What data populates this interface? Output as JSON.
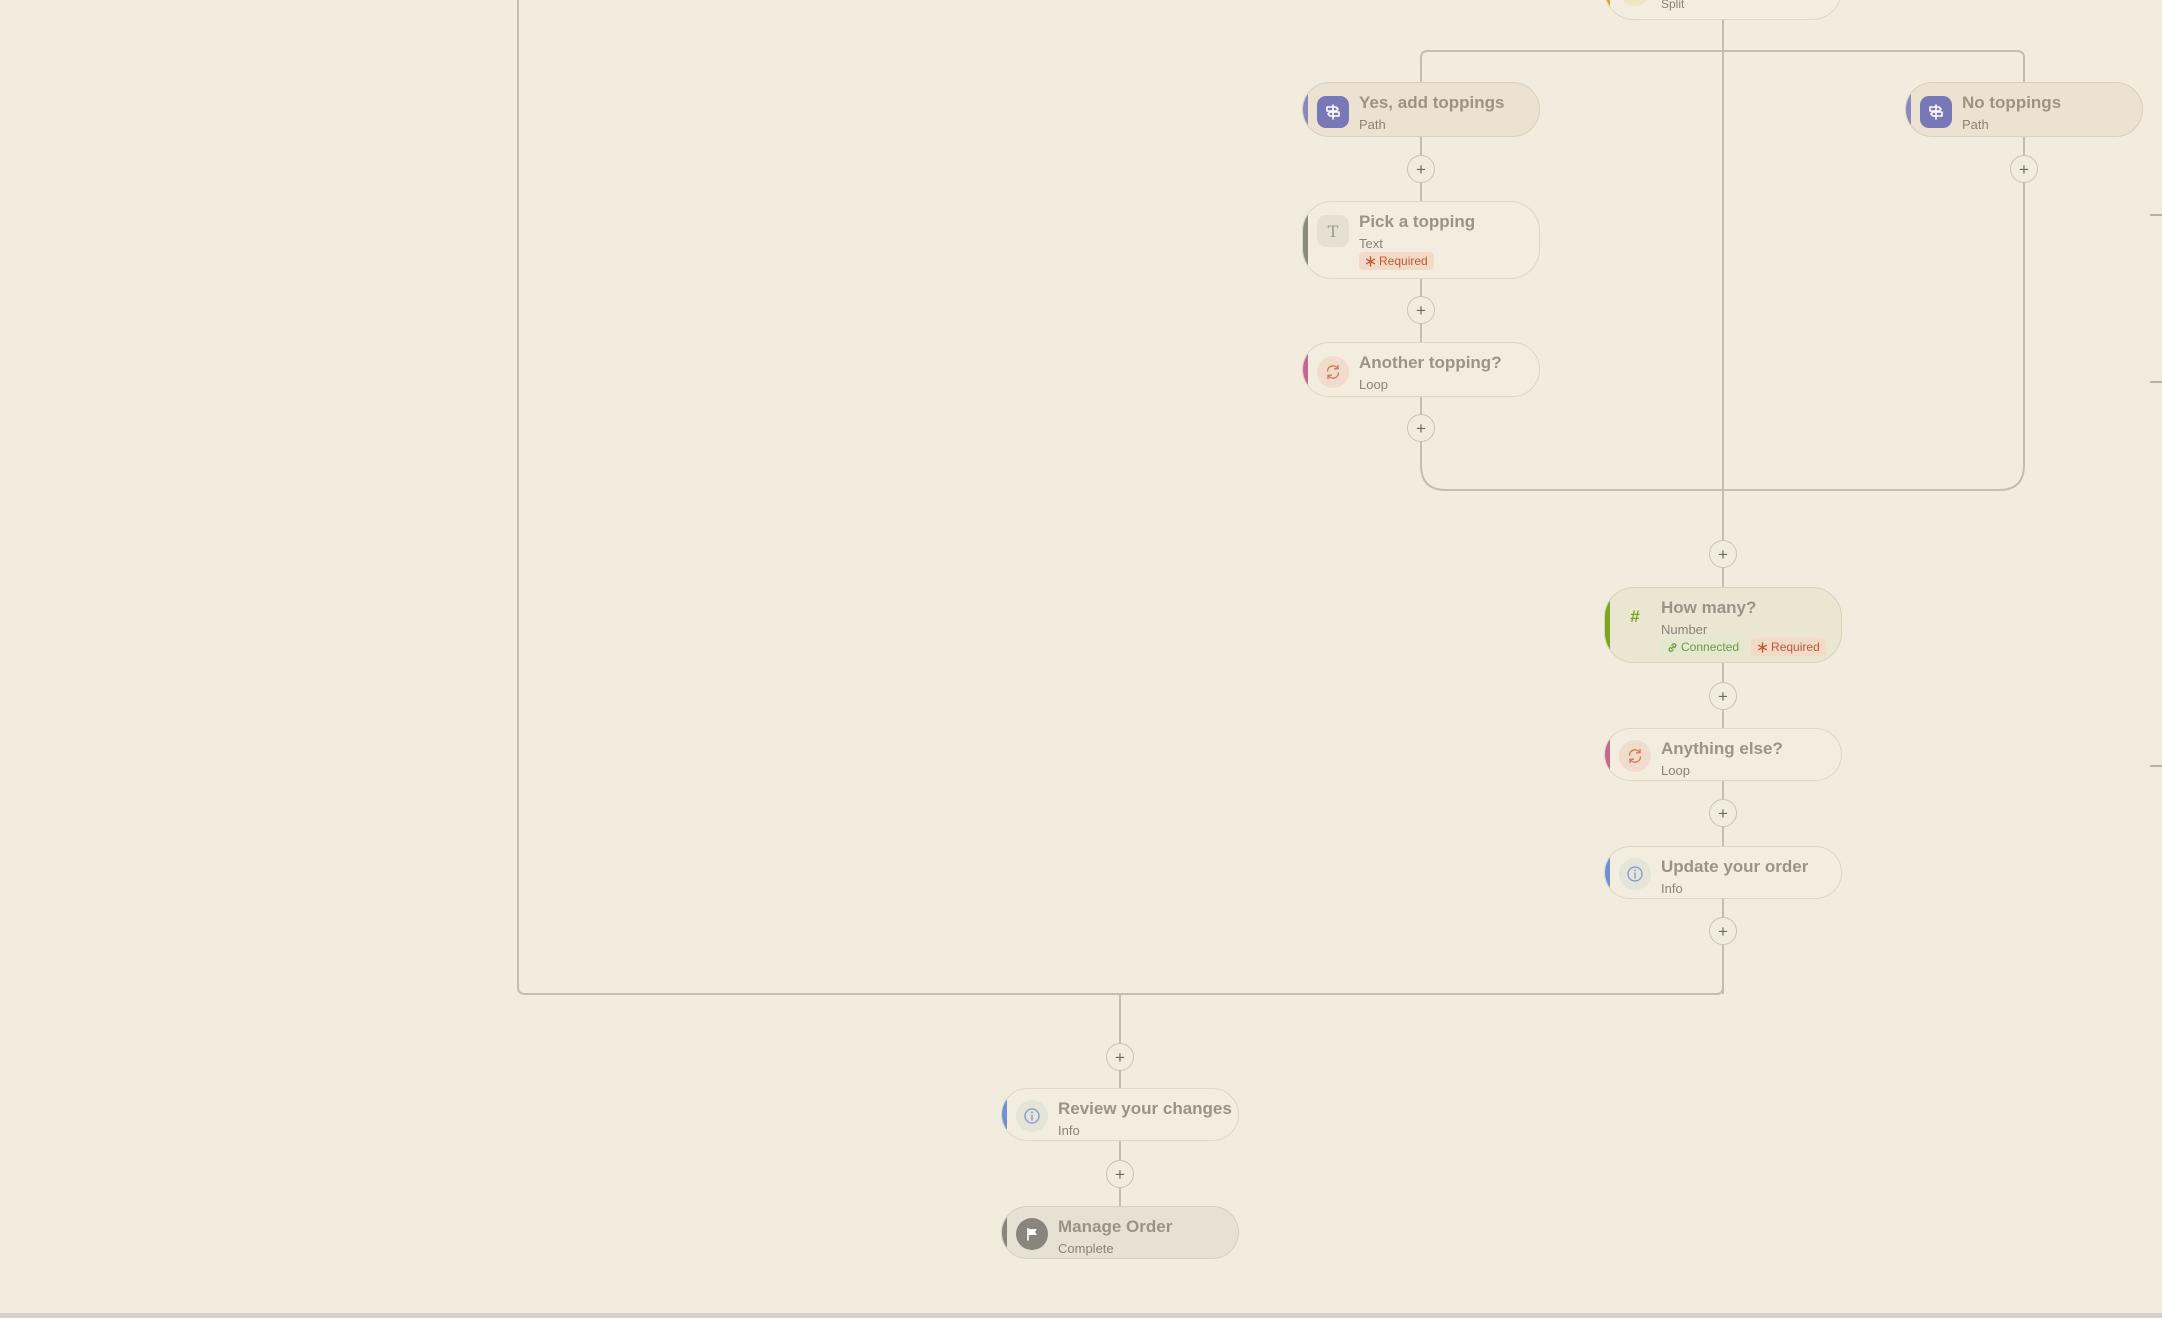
{
  "colors": {
    "background": "#f2ecde",
    "connector": "#c4beb1",
    "path_stripe": "#8a86c0",
    "path_icon_bg": "#7a77b7",
    "text_stripe": "#8a8a7a",
    "loop_stripe": "#c8658e",
    "info_stripe": "#6f8fd8",
    "number_stripe": "#7ea320",
    "complete_stripe": "#8a857c",
    "split_stripe": "#d7a420",
    "required_text": "#c25636",
    "connected_text": "#6e9a42"
  },
  "split_node": {
    "subtitle": "Split"
  },
  "plus_label": "+",
  "nodes": {
    "yes_toppings": {
      "title": "Yes, add toppings",
      "subtitle": "Path",
      "icon": "signpost-icon"
    },
    "no_toppings": {
      "title": "No toppings",
      "subtitle": "Path",
      "icon": "signpost-icon"
    },
    "pick_topping": {
      "title": "Pick a topping",
      "subtitle": "Text",
      "icon": "text-icon",
      "icon_glyph": "T",
      "badges": {
        "required": "Required"
      }
    },
    "another_topping": {
      "title": "Another topping?",
      "subtitle": "Loop",
      "icon": "loop-icon"
    },
    "how_many": {
      "title": "How many?",
      "subtitle": "Number",
      "icon": "hash-icon",
      "icon_glyph": "#",
      "badges": {
        "connected": "Connected",
        "required": "Required"
      }
    },
    "anything_else": {
      "title": "Anything else?",
      "subtitle": "Loop",
      "icon": "loop-icon"
    },
    "update_order": {
      "title": "Update your order",
      "subtitle": "Info",
      "icon": "info-icon"
    },
    "review_changes": {
      "title": "Review your changes",
      "subtitle": "Info",
      "icon": "info-icon"
    },
    "manage_order": {
      "title": "Manage Order",
      "subtitle": "Complete",
      "icon": "flag-icon"
    }
  }
}
